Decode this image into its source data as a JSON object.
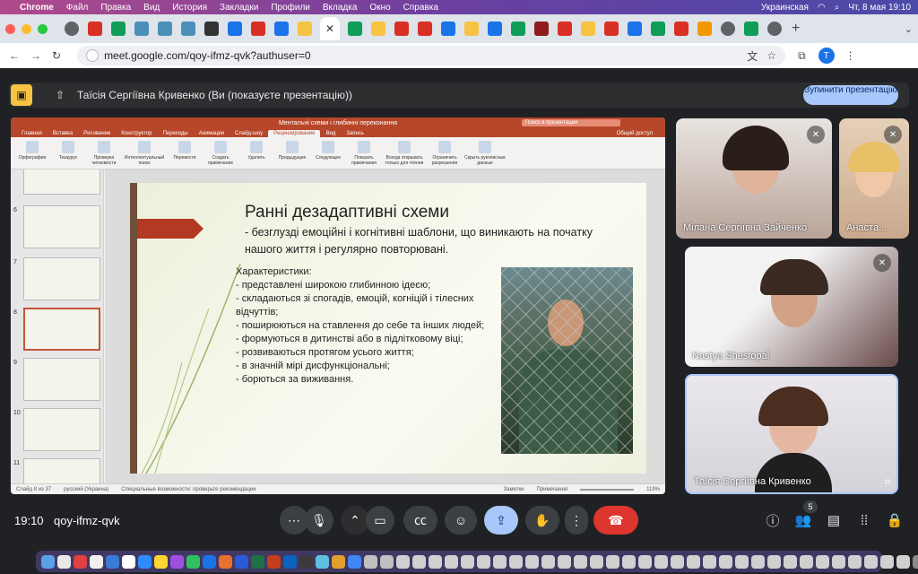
{
  "menubar": {
    "app": "Chrome",
    "items": [
      "Файл",
      "Правка",
      "Вид",
      "История",
      "Закладки",
      "Профили",
      "Вкладка",
      "Окно",
      "Справка"
    ],
    "keyboard": "Украинская",
    "datetime": "Чт, 8 мая 19:10"
  },
  "tab": {
    "close_glyph": "✕"
  },
  "address": {
    "url": "meet.google.com/qoy-ifmz-qvk?authuser=0",
    "avatar_letter": "T"
  },
  "presentation": {
    "banner_text": "Таїсія Сергіївна Кривенко (Ви (показуєте презентацію))",
    "stop_button": "Зупинити презентацію"
  },
  "powerpoint": {
    "title": "Ментальні схеми і глибинні переконання",
    "search_placeholder": "Поиск в презентации",
    "share": "Общий доступ",
    "tabs": [
      "Главная",
      "Вставка",
      "Рисование",
      "Конструктор",
      "Переходы",
      "Анимации",
      "Слайд-шоу",
      "Рецензирование",
      "Вид",
      "Запись"
    ],
    "active_tab": "Рецензирование",
    "ribbon": [
      "Орфография",
      "Тезаурус",
      "Проверка читаемости",
      "Интеллектуальный поиск",
      "Перевести",
      "Создать примечание",
      "Удалить",
      "Предыдущее",
      "Следующее",
      "Показать примечания",
      "Всегда открывать только для чтения",
      "Ограничить разрешения",
      "Скрыть рукописные данные"
    ],
    "thumb_numbers": [
      "6",
      "7",
      "8",
      "9",
      "10",
      "11"
    ],
    "status": {
      "slide": "Слайд 8 из 37",
      "lang": "русский (Украина)",
      "access": "Специальные возможности: проверьте рекомендации",
      "notes": "Заметки",
      "comments": "Примечания",
      "zoom": "119%"
    },
    "slide": {
      "title": "Ранні дезадаптивні схеми",
      "subtitle": "- безглузді емоційні і когнітивні шаблони, що виникають на початку нашого життя і регулярно повторювані.",
      "characteristics": "Характеристики:\n- представлені широкою глибинною ідеєю;\n- складаються зі спогадів, емоцій, когніцій і тілесних відчуттів;\n- поширюються на ставлення до себе та інших людей;\n- формуються в дитинстві або в підлітковому віці;\n- розвиваються протягом усього життя;\n- в значній мірі дисфункціональні;\n- борються за виживання."
    }
  },
  "participants": [
    {
      "name": "Мілана Сергіївна Зайченко",
      "muted": true
    },
    {
      "name": "Анаста...",
      "muted": true
    },
    {
      "name": "Nastya Shestopal",
      "muted": true
    },
    {
      "name": "Таїсія Сергіївна Кривенко",
      "muted": false
    }
  ],
  "bottom": {
    "time": "19:10",
    "code": "qoy-ifmz-qvk",
    "people_count": "5"
  },
  "colors": {
    "accent": "#a8c7fa",
    "end_call": "#dc362e",
    "ppt_red": "#b7472a"
  }
}
